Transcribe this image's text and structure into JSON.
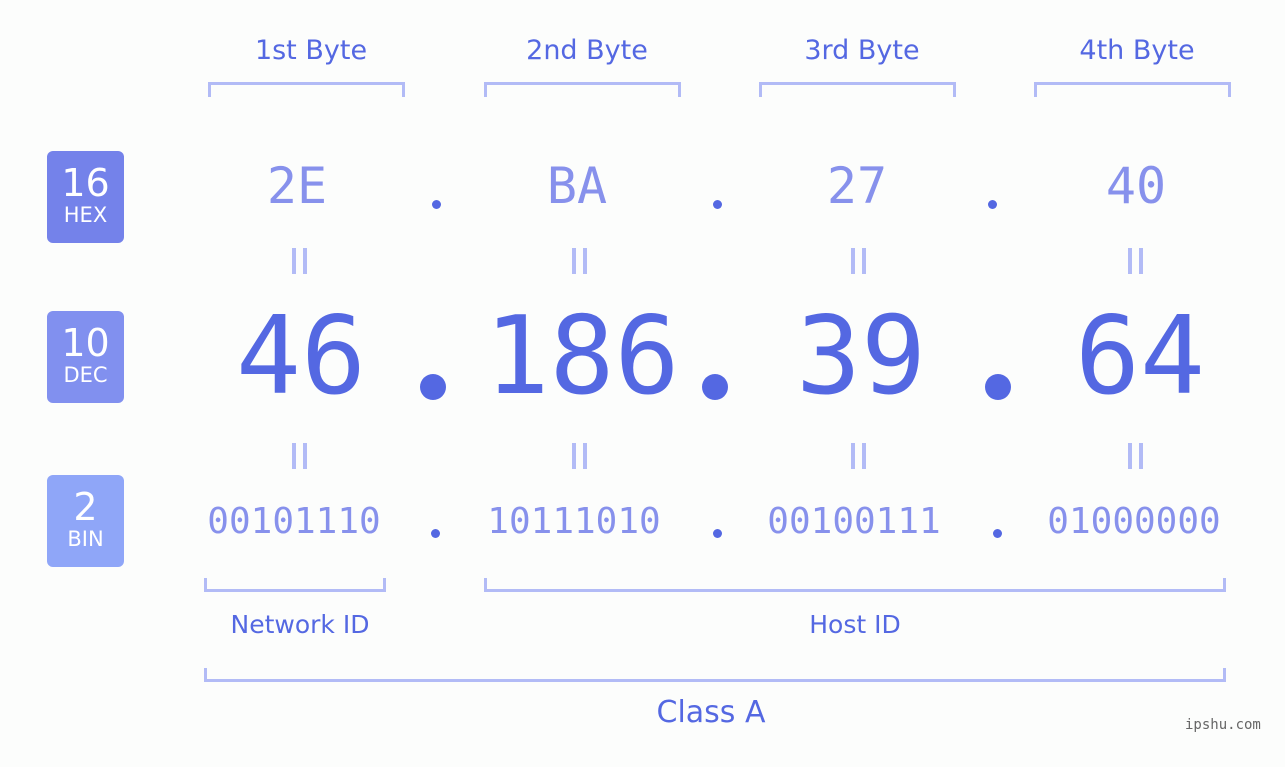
{
  "byte_headers": [
    "1st Byte",
    "2nd Byte",
    "3rd Byte",
    "4th Byte"
  ],
  "badges": {
    "hex": {
      "num": "16",
      "name": "HEX",
      "color": "#7482ea"
    },
    "dec": {
      "num": "10",
      "name": "DEC",
      "color": "#8190ef"
    },
    "bin": {
      "num": "2",
      "name": "BIN",
      "color": "#8fa6f8"
    }
  },
  "address": {
    "hex": [
      "2E",
      "BA",
      "27",
      "40"
    ],
    "dec": [
      "46",
      "186",
      "39",
      "64"
    ],
    "bin": [
      "00101110",
      "10111010",
      "00100111",
      "01000000"
    ]
  },
  "labels": {
    "network_id": "Network ID",
    "host_id": "Host ID",
    "class": "Class A"
  },
  "watermark": "ipshu.com",
  "colors": {
    "accent": "#5468e2",
    "light_text": "#8791ec",
    "bracket": "#b2bbf6",
    "background": "#fcfdfc"
  }
}
